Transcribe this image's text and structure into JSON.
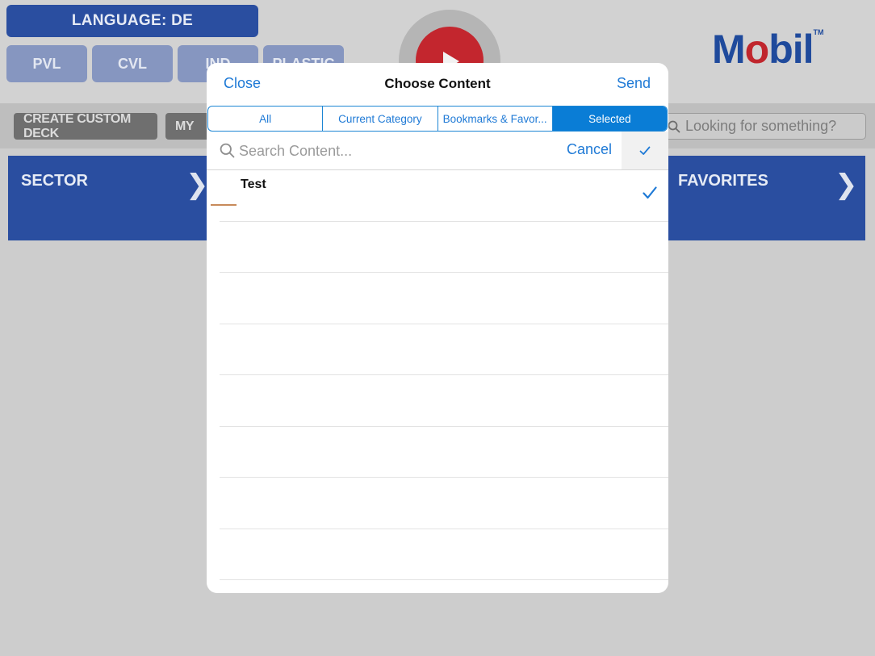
{
  "header": {
    "language_button": "LANGUAGE: DE",
    "segments": [
      "PVL",
      "CVL",
      "IND",
      "PLASTIC"
    ],
    "logo_text_pre": "M",
    "logo_text_o": "o",
    "logo_text_post": "bil",
    "logo_tm": "TM"
  },
  "toolbar": {
    "create_deck_label": "CREATE CUSTOM DECK",
    "my_label": "MY",
    "search_placeholder": "Looking for something?"
  },
  "tiles": {
    "sector_label": "SECTOR",
    "favorites_label": "FAVORITES"
  },
  "modal": {
    "close_label": "Close",
    "title": "Choose Content",
    "send_label": "Send",
    "tabs": [
      {
        "label": "All",
        "active": false
      },
      {
        "label": "Current Category",
        "active": false
      },
      {
        "label": "Bookmarks & Favor...",
        "active": false
      },
      {
        "label": "Selected",
        "active": true
      }
    ],
    "search_placeholder": "Search Content...",
    "search_value": "",
    "cancel_label": "Cancel",
    "items": [
      {
        "title": "Test",
        "selected": true
      }
    ],
    "empty_rows": 7
  },
  "colors": {
    "accent": "#1f7ad6",
    "tab_active": "#0a7dd6",
    "brand_blue": "#2a4ea0",
    "brand_red": "#c0262d"
  }
}
